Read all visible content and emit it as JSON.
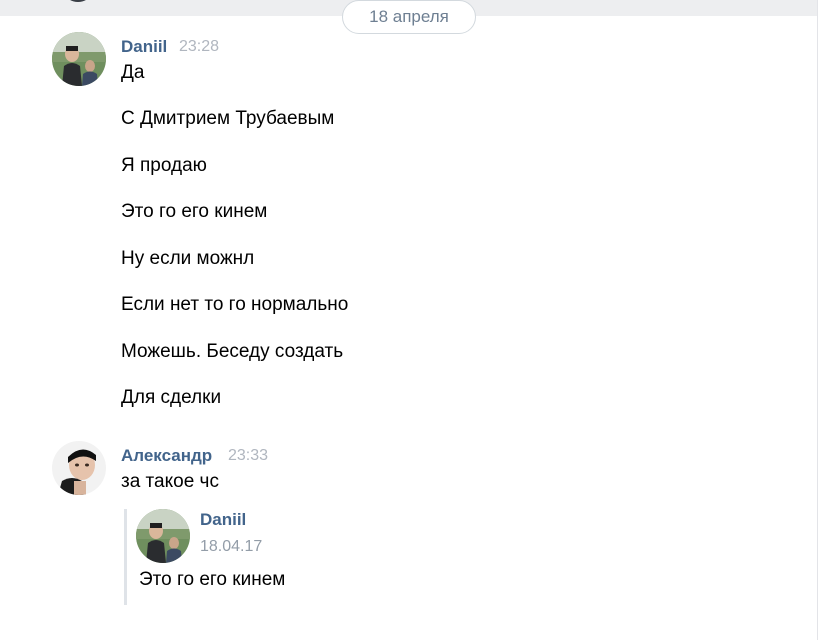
{
  "date_separator": "18 апреля",
  "messages": [
    {
      "author": "Daniil",
      "time": "23:28",
      "avatar_icon": "user-avatar-icon",
      "lines": [
        "Да",
        "С Дмитрием Трубаевым",
        "Я продаю",
        "Это го его кинем",
        "Ну если можнл",
        "Если нет то го нормально",
        "Можешь. Беседу создать",
        "Для сделки"
      ]
    },
    {
      "author": "Александр",
      "time": "23:33",
      "avatar_icon": "user-avatar-icon",
      "lines": [
        "за такое чс"
      ],
      "forwarded": {
        "author": "Daniil",
        "date": "18.04.17",
        "text": "Это го его кинем"
      }
    }
  ],
  "colors": {
    "author": "#42648b",
    "time": "#b0b6bf",
    "pill_text": "#6e7f92",
    "pill_border": "#d3d9de",
    "top_band": "#edeef0",
    "quote_bar": "#dfe3e8"
  }
}
